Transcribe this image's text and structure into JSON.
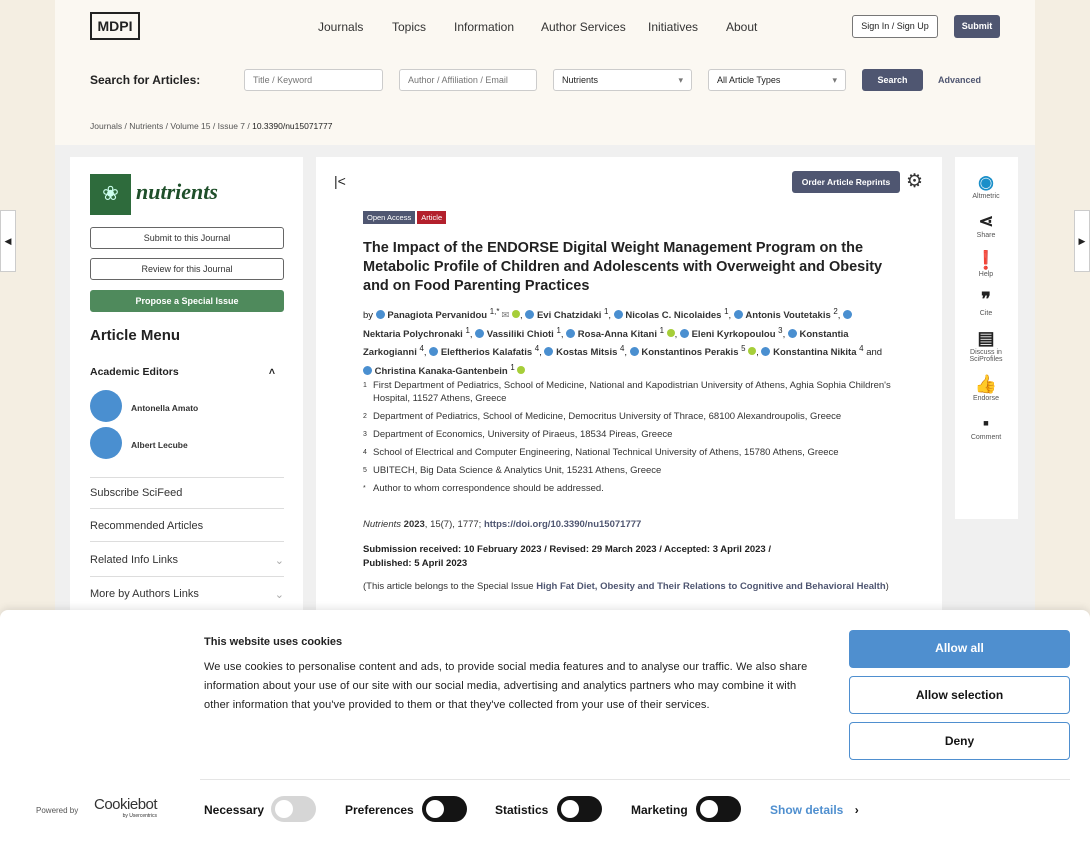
{
  "header": {
    "logo": "MDPI",
    "nav": [
      "Journals",
      "Topics",
      "Information",
      "Author Services",
      "Initiatives",
      "About"
    ],
    "signin": "Sign In / Sign Up",
    "submit": "Submit"
  },
  "search": {
    "label": "Search for Articles:",
    "title_placeholder": "Title / Keyword",
    "author_placeholder": "Author / Affiliation / Email",
    "journal": "Nutrients",
    "types": "All Article Types",
    "button": "Search",
    "advanced": "Advanced"
  },
  "breadcrumb": [
    "Journals",
    "Nutrients",
    "Volume 15",
    "Issue 7",
    "10.3390/nu15071777"
  ],
  "sidebar": {
    "journal": "nutrients",
    "submit": "Submit to this Journal",
    "review": "Review for this Journal",
    "propose": "Propose a Special Issue",
    "menu_title": "Article Menu",
    "editors_title": "Academic Editors",
    "editors": [
      "Antonella Amato",
      "Albert Lecube"
    ],
    "links": [
      "Subscribe SciFeed",
      "Recommended Articles",
      "Related Info Links",
      "More by Authors Links"
    ]
  },
  "article": {
    "order": "Order Article Reprints",
    "badges": [
      "Open Access",
      "Article"
    ],
    "title": "The Impact of the ENDORSE Digital Weight Management Program on the Metabolic Profile of Children and Adolescents with Overweight and Obesity and on Food Parenting Practices",
    "by": "by",
    "and": "and",
    "authors": [
      {
        "name": "Panagiota Pervanidou",
        "sup": "1,*"
      },
      {
        "name": "Evi Chatzidaki",
        "sup": "1"
      },
      {
        "name": "Nicolas C. Nicolaides",
        "sup": "1"
      },
      {
        "name": "Antonis Voutetakis",
        "sup": "2"
      },
      {
        "name": "Nektaria Polychronaki",
        "sup": "1"
      },
      {
        "name": "Vassiliki Chioti",
        "sup": "1"
      },
      {
        "name": "Rosa-Anna Kitani",
        "sup": "1"
      },
      {
        "name": "Eleni Kyrkopoulou",
        "sup": "3"
      },
      {
        "name": "Konstantia Zarkogianni",
        "sup": "4"
      },
      {
        "name": "Eleftherios Kalafatis",
        "sup": "4"
      },
      {
        "name": "Kostas Mitsis",
        "sup": "4"
      },
      {
        "name": "Konstantinos Perakis",
        "sup": "5"
      },
      {
        "name": "Konstantina Nikita",
        "sup": "4"
      },
      {
        "name": "Christina Kanaka-Gantenbein",
        "sup": "1"
      }
    ],
    "affiliations": [
      {
        "n": "1",
        "t": "First Department of Pediatrics, School of Medicine, National and Kapodistrian University of Athens, Aghia Sophia Children's Hospital, 11527 Athens, Greece"
      },
      {
        "n": "2",
        "t": "Department of Pediatrics, School of Medicine, Democritus University of Thrace, 68100 Alexandroupolis, Greece"
      },
      {
        "n": "3",
        "t": "Department of Economics, University of Piraeus, 18534 Pireas, Greece"
      },
      {
        "n": "4",
        "t": "School of Electrical and Computer Engineering, National Technical University of Athens, 15780 Athens, Greece"
      },
      {
        "n": "5",
        "t": "UBITECH, Big Data Science & Analytics Unit, 15231 Athens, Greece"
      },
      {
        "n": "*",
        "t": "Author to whom correspondence should be addressed."
      }
    ],
    "cite_journal": "Nutrients",
    "cite_year": "2023",
    "cite_rest": ", 15(7), 1777; ",
    "doi": "https://doi.org/10.3390/nu15071777",
    "dates1": "Submission received: 10 February 2023 / Revised: 29 March 2023 / Accepted: 3 April 2023 /",
    "dates2": "Published: 5 April 2023",
    "special_pre": "(This article belongs to the Special Issue ",
    "special": "High Fat Diet, Obesity and Their Relations to Cognitive and Behavioral Health",
    ")": ")"
  },
  "tools": [
    {
      "icon": "altmetric-icon",
      "label": "Altmetric"
    },
    {
      "icon": "share-icon",
      "label": "Share"
    },
    {
      "icon": "help-icon",
      "label": "Help"
    },
    {
      "icon": "cite-icon",
      "label": "Cite"
    },
    {
      "icon": "discuss-icon",
      "label": "Discuss in SciProfiles"
    },
    {
      "icon": "endorse-icon",
      "label": "Endorse"
    },
    {
      "icon": "comment-icon",
      "label": "Comment"
    }
  ],
  "cookie": {
    "title": "This website uses cookies",
    "text": "We use cookies to personalise content and ads, to provide social media features and to analyse our traffic. We also share information about your use of our site with our social media, advertising and analytics partners who may combine it with other information that you've provided to them or that they've collected from your use of their services.",
    "allow_all": "Allow all",
    "allow_selection": "Allow selection",
    "deny": "Deny",
    "powered": "Powered by",
    "brand": "Cookiebot",
    "brand_sub": "by Usercentrics",
    "toggles": [
      "Necessary",
      "Preferences",
      "Statistics",
      "Marketing"
    ],
    "show_details": "Show details",
    "accent": "#4f8fcf"
  }
}
